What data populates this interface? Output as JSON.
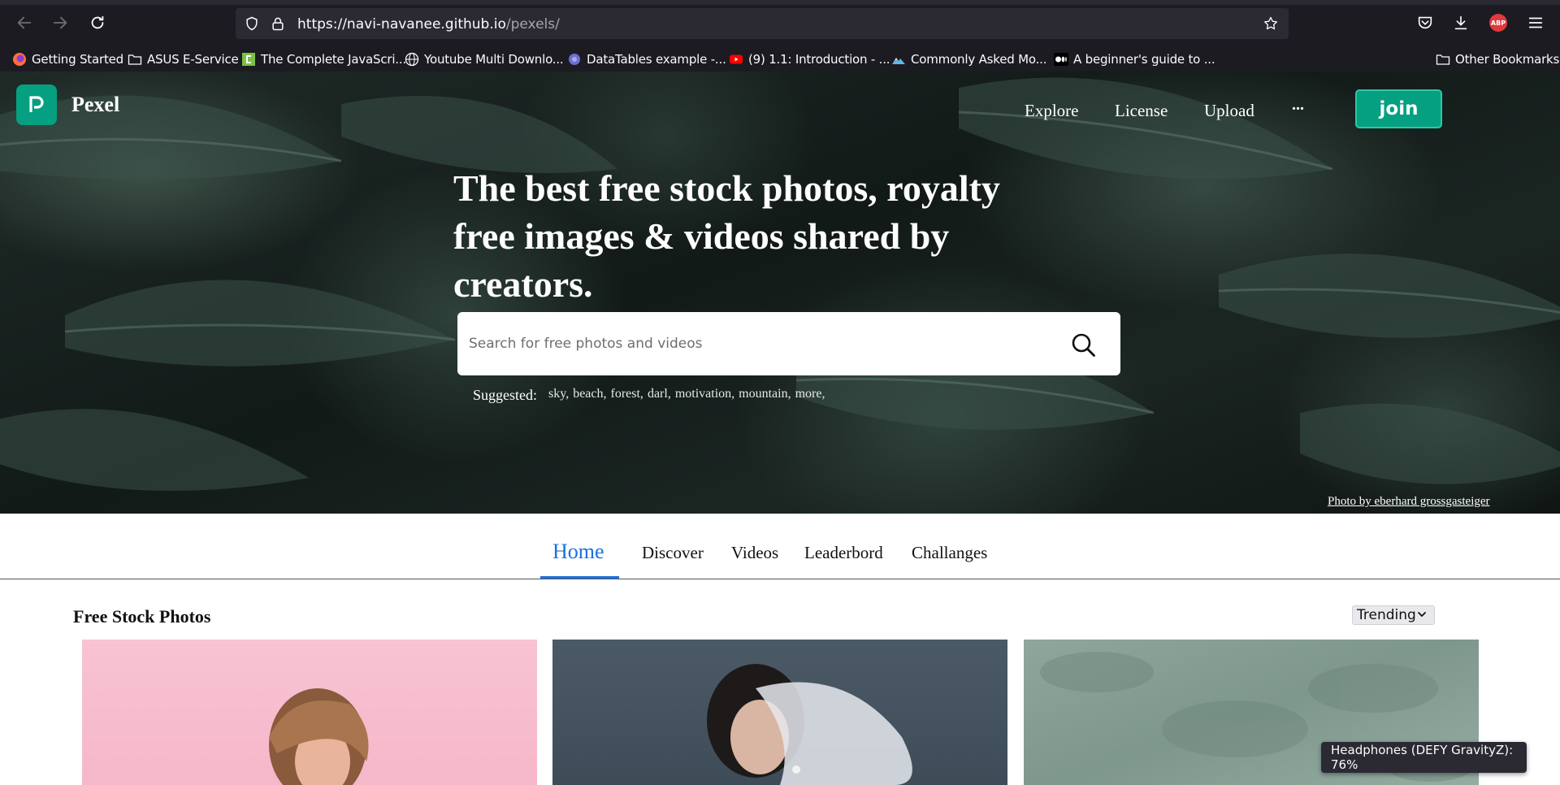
{
  "browser": {
    "url_host": "https://navi-navanee.github.io",
    "url_path": "/pexels/",
    "bookmarks": [
      {
        "label": "Getting Started",
        "icon": "firefox-icon"
      },
      {
        "label": "ASUS E-Service",
        "icon": "folder-icon"
      },
      {
        "label": "The Complete JavaScri...",
        "icon": "green-bookmark-icon"
      },
      {
        "label": "Youtube Multi Downlo...",
        "icon": "globe-icon"
      },
      {
        "label": "DataTables example -...",
        "icon": "datatables-icon"
      },
      {
        "label": "(9) 1.1: Introduction - ...",
        "icon": "youtube-icon"
      },
      {
        "label": "Commonly Asked Mo...",
        "icon": "mountain-icon"
      },
      {
        "label": "A beginner's guide to ...",
        "icon": "medium-icon"
      }
    ],
    "other_bookmarks": "Other Bookmarks",
    "abp_label": "ABP"
  },
  "site": {
    "brand": "Pexel",
    "nav": [
      "Explore",
      "License",
      "Upload"
    ],
    "more": "...",
    "join": "join",
    "headline": "The best free stock photos, royalty free images & videos shared by creators.",
    "search_placeholder": "Search for free photos and videos",
    "suggested_label": "Suggested:",
    "suggestions": [
      "sky,",
      "beach,",
      "forest,",
      "darl,",
      "motivation,",
      "mountain,",
      "more,"
    ],
    "photo_credit": "Photo by eberhard grossgasteiger"
  },
  "tabs": [
    "Home",
    "Discover",
    "Videos",
    "Leaderbord",
    "Challanges"
  ],
  "content": {
    "section_title": "Free Stock Photos",
    "sort_selected": "Trending"
  },
  "toast": "Headphones (DEFY GravityZ): 76%",
  "colors": {
    "brand_green": "#05a081",
    "tab_active": "#1d6fe0",
    "chrome_bg": "#1c1b22"
  }
}
